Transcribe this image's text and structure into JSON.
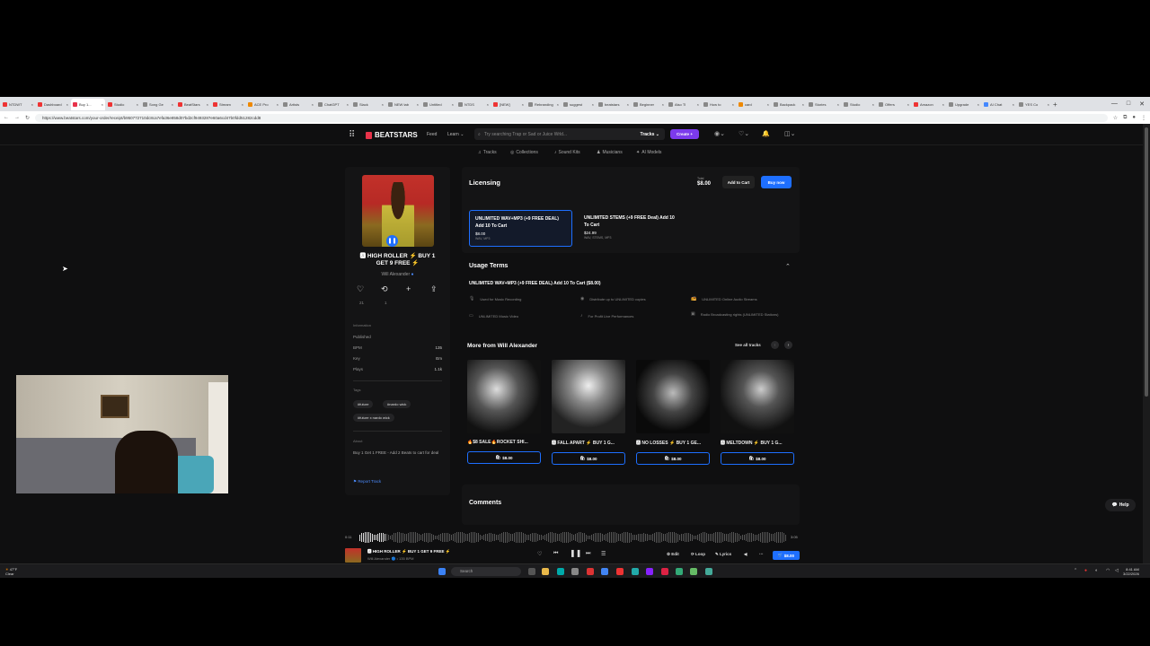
{
  "browser": {
    "tabs": [
      {
        "label": "NTDWT",
        "color": "#e33"
      },
      {
        "label": "Dashboard",
        "color": "#e33"
      },
      {
        "label": "Buy 1...",
        "color": "#e8334a",
        "active": true
      },
      {
        "label": "Studio",
        "color": "#e33"
      },
      {
        "label": "Song Ge",
        "color": "#888"
      },
      {
        "label": "BeatStars",
        "color": "#e33"
      },
      {
        "label": "Stream",
        "color": "#e33"
      },
      {
        "label": "ACE Pro",
        "color": "#e80"
      },
      {
        "label": "Artists",
        "color": "#888"
      },
      {
        "label": "ChatGPT",
        "color": "#888"
      },
      {
        "label": "Slack",
        "color": "#888"
      },
      {
        "label": "NEW tab",
        "color": "#888"
      },
      {
        "label": "Untitled",
        "color": "#888"
      },
      {
        "label": "NTDS",
        "color": "#888"
      },
      {
        "label": "[NEW]",
        "color": "#e33"
      },
      {
        "label": "Rebranding",
        "color": "#888"
      },
      {
        "label": "suggest",
        "color": "#888"
      },
      {
        "label": "beatstars",
        "color": "#888"
      },
      {
        "label": "Beginner",
        "color": "#888"
      },
      {
        "label": "Also TI",
        "color": "#888"
      },
      {
        "label": "How to",
        "color": "#888"
      },
      {
        "label": "card",
        "color": "#e80"
      },
      {
        "label": "Backpack",
        "color": "#888"
      },
      {
        "label": "Stories",
        "color": "#888"
      },
      {
        "label": "Studio",
        "color": "#888"
      },
      {
        "label": "Offers",
        "color": "#888"
      },
      {
        "label": "Amazon",
        "color": "#e33"
      },
      {
        "label": "Upgrade",
        "color": "#888"
      },
      {
        "label": "AI Chat",
        "color": "#48f"
      },
      {
        "label": "YES Co",
        "color": "#888"
      }
    ],
    "url": "https://www.beatstars.com/your-order/receipt/b950772710dc8ca7efa36e858d07bd2cf9493287e60a6cd47b0fdd51282cdd8"
  },
  "nav": {
    "logo": "BEATSTARS",
    "feed": "Feed",
    "learn": "Learn",
    "search_placeholder": "Try searching Trap or Sad or Juice Wrld...",
    "search_scope": "Tracks",
    "create": "Create"
  },
  "subnav": [
    "Tracks",
    "Collections",
    "Sound Kits",
    "Musicians",
    "AI Models"
  ],
  "track": {
    "title": "🅰 HIGH ROLLER ⚡ BUY 1 GET 9 FREE ⚡",
    "artist": "Will Alexander",
    "likes": "21",
    "reposts": "1",
    "info_label": "Information",
    "published_label": "Published",
    "bpm_label": "BPM",
    "bpm": "135",
    "key_label": "Key",
    "key": "Em",
    "plays_label": "Plays",
    "plays": "1.1k",
    "tags_label": "Tags",
    "tags": [
      "#future",
      "#nardo wick",
      "#future x nardo wick"
    ],
    "about_label": "About",
    "about": "Buy 1 Get 1 FREE - Add 2 Beats to cart for deal",
    "report": "Report Track"
  },
  "licensing": {
    "title": "Licensing",
    "total_label": "Total",
    "total": "$8.00",
    "add_to_cart": "Add to Cart",
    "buy_now": "Buy now",
    "options": [
      {
        "name": "UNLIMITED WAV+MP3 (+9 FREE DEAL) Add 10 To Cart",
        "price": "$8.00",
        "formats": "WAV, MP3",
        "selected": true
      },
      {
        "name": "UNLIMITED STEMS (+9 FREE Deal) Add 10 To Cart",
        "price": "$24.99",
        "formats": "WAV, STEMS, MP3",
        "selected": false
      }
    ]
  },
  "usage": {
    "title": "Usage Terms",
    "subtitle": "UNLIMITED WAV+MP3 (+9 FREE DEAL) Add 10 To Cart ($8.00)",
    "items": [
      {
        "icon": "mic-icon",
        "text": "Used for Music Recording"
      },
      {
        "icon": "disc-icon",
        "text": "Distribute up to UNLIMITED copies"
      },
      {
        "icon": "radio-icon",
        "text": "UNLIMITED Online Audio Streams"
      },
      {
        "icon": "video-icon",
        "text": "UNLIMITED Music Video"
      },
      {
        "icon": "guitar-icon",
        "text": "For Profit Live Performances"
      },
      {
        "icon": "broadcast-icon",
        "text": "Radio Broadcasting rights (UNLIMITED Stations)"
      }
    ]
  },
  "more": {
    "title": "More from Will Alexander",
    "see_all": "See all tracks",
    "cards": [
      {
        "title": "🔥$8 SALE🔥ROCKET SHI...",
        "price": "$8.00"
      },
      {
        "title": "🅰 FALL APART ⚡ BUY 1 G...",
        "price": "$8.00"
      },
      {
        "title": "🅰 NO LOSSES ⚡ BUY 1 GE...",
        "price": "$8.00"
      },
      {
        "title": "🅰 MELTDOWN ⚡ BUY 1 G...",
        "price": "$8.00"
      }
    ]
  },
  "comments": {
    "title": "Comments"
  },
  "help": "Help",
  "player": {
    "time_start": "0:11",
    "time_end": "3:05",
    "title": "🅰 HIGH ROLLER ⚡ BUY 1 GET 9 FREE ⚡",
    "sub": "Will Alexander 🔵 • 135 BPM",
    "edit": "Edit",
    "loop": "Loop",
    "lyrics": "Lyrics",
    "price": "$8.00"
  },
  "taskbar": {
    "weather_temp": "47°F",
    "weather_desc": "Clear",
    "search": "Search",
    "time": "8:41 AM",
    "date": "3/22/2026"
  }
}
